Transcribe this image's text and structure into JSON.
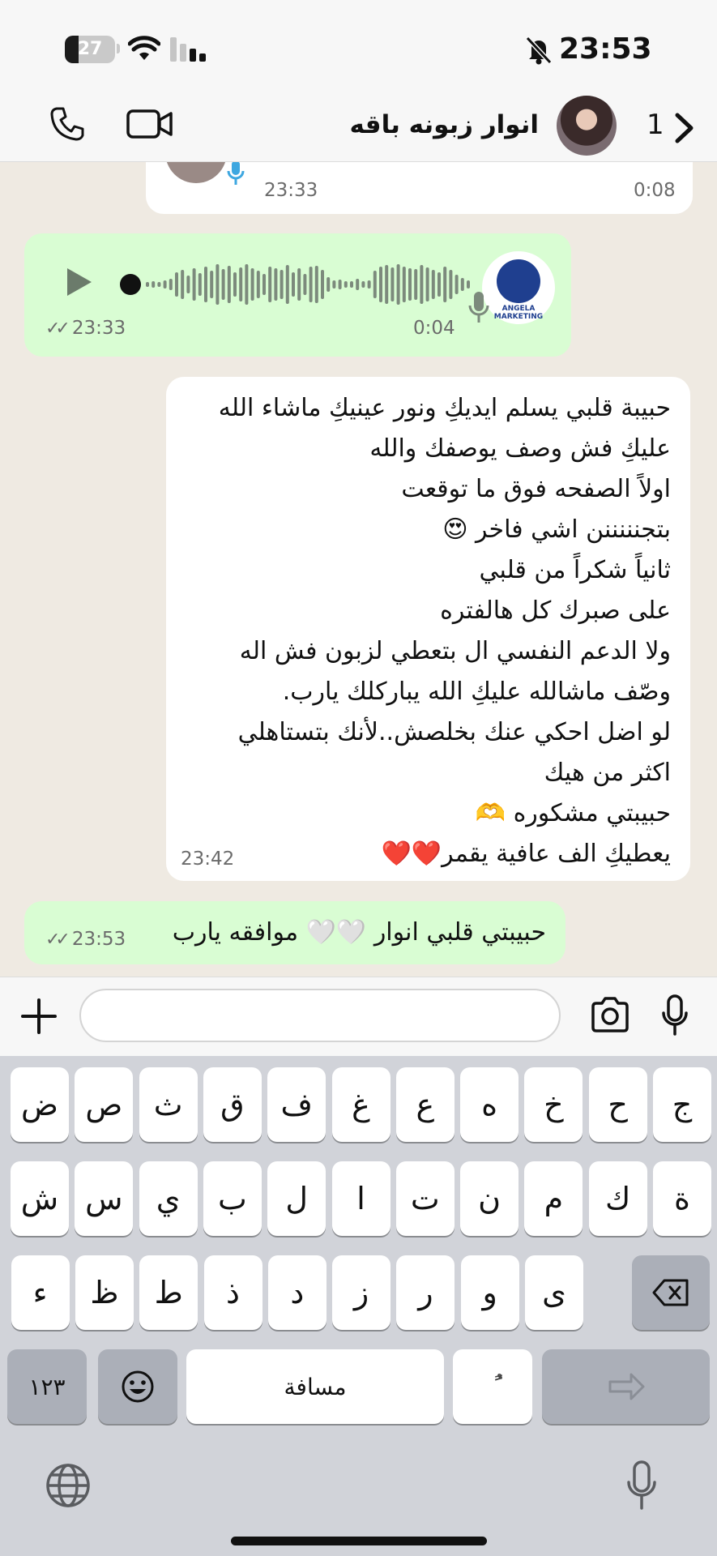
{
  "status_bar": {
    "battery_level": "27",
    "battery_fraction": 0.27,
    "time": "23:53"
  },
  "header": {
    "contact_name": "انوار زبونه باقه",
    "unread_count": "1"
  },
  "messages": [
    {
      "type": "voice",
      "direction": "incoming",
      "time": "23:33",
      "duration": "0:08"
    },
    {
      "type": "voice",
      "direction": "outgoing",
      "time": "23:33",
      "duration": "0:04",
      "logo_text": "ANGELA MARKETING"
    },
    {
      "type": "text",
      "direction": "incoming",
      "time": "23:42",
      "lines": [
        "حبيبة قلبي يسلم ايديكِ ونور عينيكِ ماشاء الله",
        "عليكِ فش وصف يوصفك والله",
        "اولاً الصفحه فوق ما توقعت",
        "بتجنننننن اشي فاخر 😍",
        "ثانياً شكراً من قلبي",
        "على صبرك كل هالفتره",
        " ولا الدعم النفسي ال بتعطي لزبون فش اله",
        "وصّف ماشالله عليكِ الله يباركلك يارب.",
        "لو اضل احكي عنك بخلصش..لأنك بتستاهلي",
        "اكثر من هيك",
        "حبيبتي مشكوره 🫶",
        "يعطيكِ الف عافية يقمر❤️❤️"
      ]
    },
    {
      "type": "text",
      "direction": "outgoing",
      "time": "23:53",
      "lines": [
        "حبيبتي قلبي انوار 🤍🤍 موافقه يارب"
      ]
    }
  ],
  "ticks": "✓✓",
  "composer": {
    "input_value": ""
  },
  "keyboard": {
    "row1": [
      "ج",
      "ح",
      "خ",
      "ه",
      "ع",
      "غ",
      "ف",
      "ق",
      "ث",
      "ص",
      "ض"
    ],
    "row2": [
      "ة",
      "ك",
      "م",
      "ن",
      "ت",
      "ا",
      "ل",
      "ب",
      "ي",
      "س",
      "ش"
    ],
    "row3": [
      "ى",
      "و",
      "ر",
      "ز",
      "د",
      "ذ",
      "ط",
      "ظ",
      "ء"
    ],
    "numbers_key": "١٢٣",
    "space_key": "مسافة",
    "diacritic_key": "ًُ"
  }
}
